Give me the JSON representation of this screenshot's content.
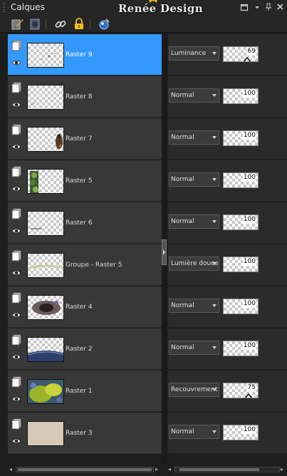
{
  "window": {
    "title": "Calques",
    "brand_watermark": "Renée Design"
  },
  "title_buttons": [
    {
      "name": "restore-window-icon"
    },
    {
      "name": "dropdown-menu-icon"
    },
    {
      "name": "pin-icon"
    },
    {
      "name": "close-icon"
    }
  ],
  "toolbar": [
    {
      "name": "edit-layer-properties-icon"
    },
    {
      "name": "mask-icon"
    },
    {
      "name": "link-layers-icon"
    },
    {
      "name": "lock-icon"
    },
    {
      "name": "blend-ranges-icon"
    }
  ],
  "colors": {
    "panel_bg": "#1e1e1e",
    "row_bg": "#383838",
    "selected_row_bg": "#3399ff"
  },
  "layers": [
    {
      "name": "Raster 9",
      "blend": "Luminance",
      "opacity": 69,
      "selected": true,
      "thumb": "sparse-dots"
    },
    {
      "name": "Raster 8",
      "blend": "Normal",
      "opacity": 100,
      "selected": false,
      "thumb": "faint-mark"
    },
    {
      "name": "Raster 7",
      "blend": "Normal",
      "opacity": 100,
      "selected": false,
      "thumb": "dark-figure-right"
    },
    {
      "name": "Raster 5",
      "blend": "Normal",
      "opacity": 100,
      "selected": false,
      "thumb": "green-foliage-left"
    },
    {
      "name": "Raster 6",
      "blend": "Normal",
      "opacity": 100,
      "selected": false,
      "thumb": "thin-line"
    },
    {
      "name": "Groupe - Raster 5",
      "blend": "Lumière douce",
      "opacity": 100,
      "selected": false,
      "thumb": "beige-streak"
    },
    {
      "name": "Raster 4",
      "blend": "Normal",
      "opacity": 100,
      "selected": false,
      "thumb": "dark-splash"
    },
    {
      "name": "Raster 2",
      "blend": "Normal",
      "opacity": 100,
      "selected": false,
      "thumb": "blue-ground-bottom"
    },
    {
      "name": "Raster 1",
      "blend": "Recouvrement",
      "opacity": 75,
      "selected": false,
      "thumb": "green-yellow-photo"
    },
    {
      "name": "Raster 3",
      "blend": "Normal",
      "opacity": 100,
      "selected": false,
      "thumb": "beige-solid"
    }
  ]
}
